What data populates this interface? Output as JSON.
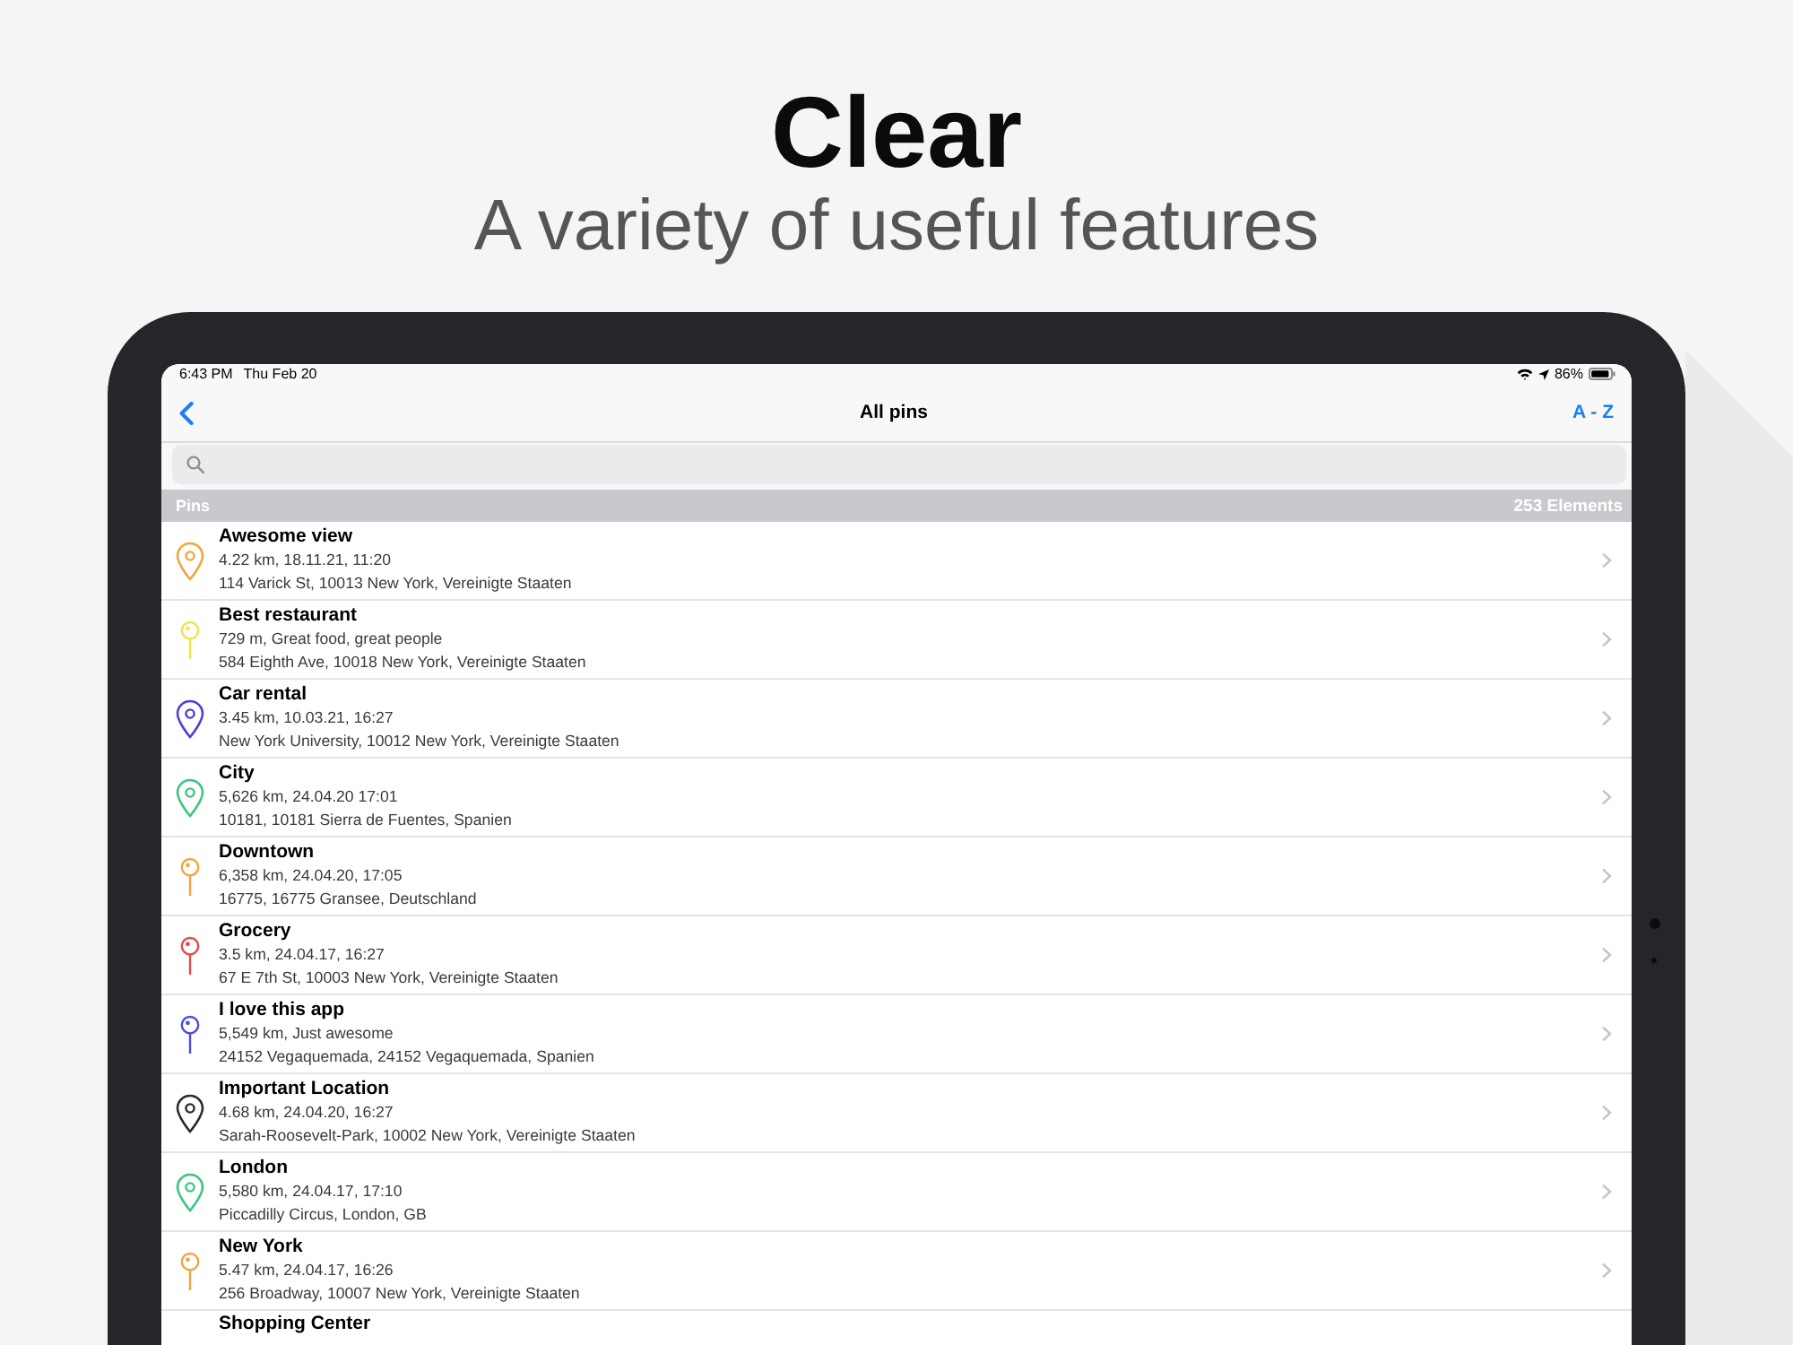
{
  "headline": {
    "title": "Clear",
    "subtitle": "A variety of useful features"
  },
  "status_bar": {
    "time": "6:43 PM",
    "date": "Thu Feb 20",
    "battery": "86%"
  },
  "nav_bar": {
    "title": "All pins",
    "sort_button": "A - Z"
  },
  "section": {
    "title": "Pins",
    "count": "253 Elements"
  },
  "rows": [
    {
      "kind": "marker",
      "color": "#f2a541",
      "title": "Awesome view",
      "detail": "4.22 km, 18.11.21, 11:20",
      "address": "114 Varick St, 10013 New York, Vereinigte Staaten"
    },
    {
      "kind": "pushpin",
      "color": "#f2e24c",
      "title": "Best restaurant",
      "detail": "729 m, Great food, great people",
      "address": "584 Eighth Ave, 10018 New York, Vereinigte Staaten"
    },
    {
      "kind": "marker",
      "color": "#4b3fd6",
      "title": "Car rental",
      "detail": "3.45 km, 10.03.21, 16:27",
      "address": "New York University, 10012 New York, Vereinigte Staaten"
    },
    {
      "kind": "marker",
      "color": "#3dc57b",
      "title": "City",
      "detail": "5,626 km, 24.04.20 17:01",
      "address": "10181, 10181 Sierra de Fuentes, Spanien"
    },
    {
      "kind": "pushpin",
      "color": "#f2a541",
      "title": "Downtown",
      "detail": "6,358 km, 24.04.20, 17:05",
      "address": "16775, 16775 Gransee, Deutschland"
    },
    {
      "kind": "pushpin",
      "color": "#e5484d",
      "title": "Grocery",
      "detail": "3.5 km, 24.04.17, 16:27",
      "address": "67 E 7th St, 10003 New York, Vereinigte Staaten"
    },
    {
      "kind": "pushpin",
      "color": "#4a4ae6",
      "title": "I love this app",
      "detail": "5,549 km, Just awesome",
      "address": "24152 Vegaquemada, 24152 Vegaquemada, Spanien"
    },
    {
      "kind": "marker",
      "color": "#2a2a2a",
      "title": "Important Location",
      "detail": "4.68 km, 24.04.20, 16:27",
      "address": "Sarah-Roosevelt-Park, 10002 New York, Vereinigte Staaten"
    },
    {
      "kind": "marker",
      "color": "#3dc57b",
      "title": "London",
      "detail": "5,580 km, 24.04.17, 17:10",
      "address": "Piccadilly Circus, London, GB"
    },
    {
      "kind": "pushpin",
      "color": "#f2a541",
      "title": "New York",
      "detail": "5.47 km, 24.04.17, 16:26",
      "address": "256 Broadway, 10007 New York, Vereinigte Staaten"
    }
  ],
  "partial_row": {
    "title": "Shopping Center"
  }
}
